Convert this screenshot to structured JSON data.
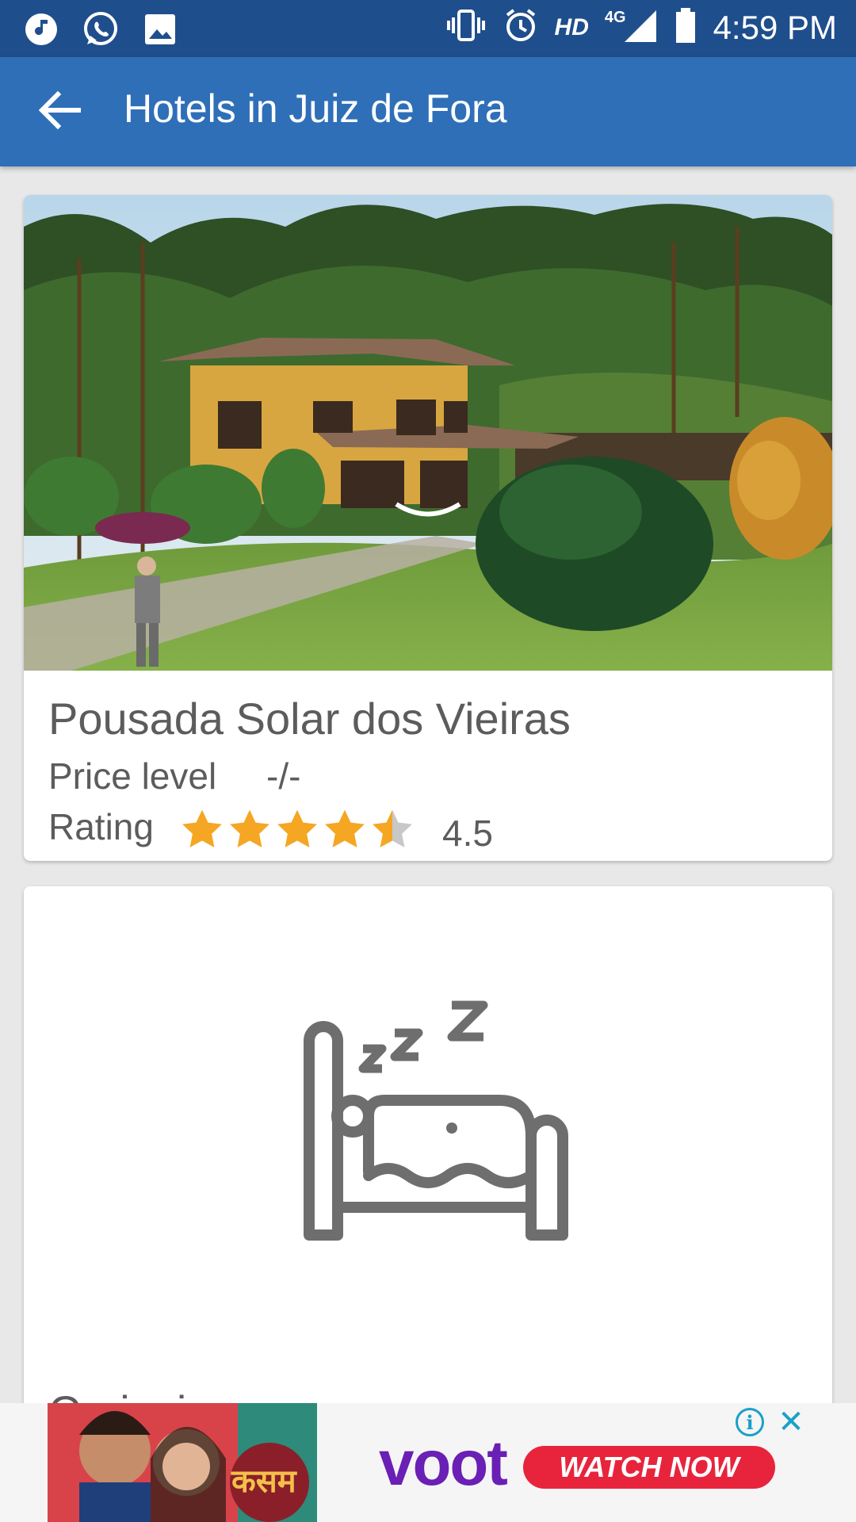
{
  "status_bar": {
    "time": "4:59 PM",
    "hd_label": "HD",
    "network_label": "4G",
    "left_icons": [
      "music-note-icon",
      "whatsapp-icon",
      "gallery-icon"
    ],
    "right_icons": [
      "vibrate-icon",
      "alarm-icon",
      "signal-icon",
      "battery-icon"
    ]
  },
  "app_bar": {
    "title": "Hotels in Juiz de Fora",
    "back_icon": "arrow-back-icon"
  },
  "hotels": [
    {
      "name": "Pousada Solar dos Vieiras",
      "price_label": "Price level",
      "price_value": "-/-",
      "rating_label": "Rating",
      "rating_value": "4.5",
      "rating_stars": 4.5
    },
    {
      "name": "Cariocica",
      "placeholder_icon": "sleeping-bed-icon"
    }
  ],
  "ad": {
    "brand": "voot",
    "cta": "WATCH NOW",
    "show_text": "कसम"
  },
  "colors": {
    "status_bar": "#1f4e8c",
    "app_bar": "#2f6fb8",
    "star": "#f5a623",
    "star_empty": "#c8c8c8",
    "text": "#5c5c5c"
  }
}
